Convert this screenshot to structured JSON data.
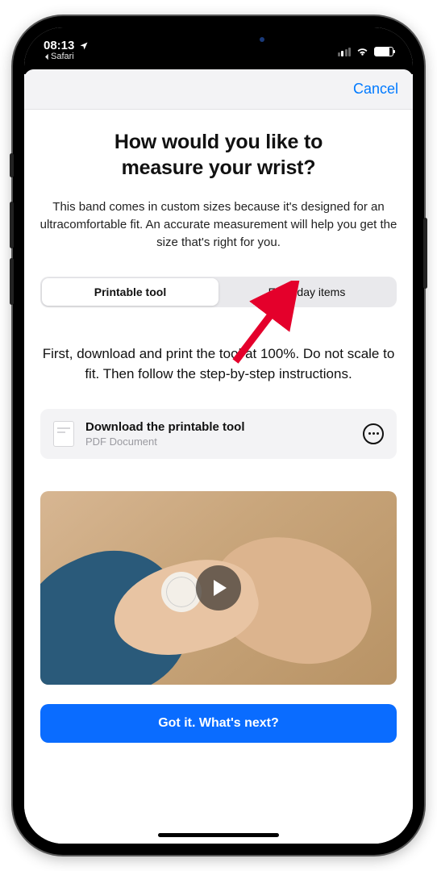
{
  "status_bar": {
    "time": "08:13",
    "back_app": "Safari"
  },
  "sheet": {
    "cancel": "Cancel",
    "title_line1": "How would you like to",
    "title_line2": "measure your wrist?",
    "description": "This band comes in custom sizes because it's designed for an ultracomfortable fit. An accurate measurement will help you get the size that's right for you.",
    "segmented": {
      "option_a": "Printable tool",
      "option_b": "Everyday items"
    },
    "instructions": "First, download and print the tool at 100%. Do not scale to fit. Then follow the step-by-step instructions.",
    "download": {
      "title": "Download the printable tool",
      "subtitle": "PDF Document"
    },
    "primary_cta": "Got it. What's next?"
  }
}
